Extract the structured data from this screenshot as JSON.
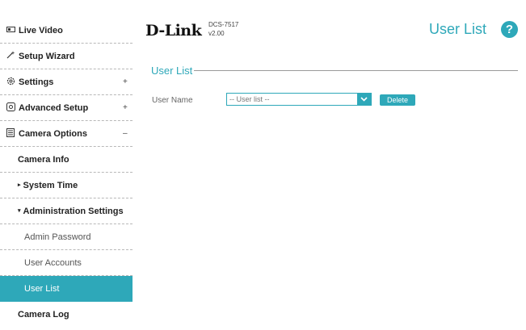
{
  "header": {
    "logo_text": "D-Link",
    "model": "DCS-7517",
    "version": "v2.00",
    "page_title": "User List",
    "help_glyph": "?"
  },
  "sidebar": {
    "items": [
      {
        "label": "Live Video",
        "icon": "video-icon"
      },
      {
        "label": "Setup Wizard",
        "icon": "wand-icon"
      },
      {
        "label": "Settings",
        "icon": "gear-icon",
        "toggle": "+"
      },
      {
        "label": "Advanced Setup",
        "icon": "advanced-gear-icon",
        "toggle": "+"
      },
      {
        "label": "Camera Options",
        "icon": "list-icon",
        "toggle": "–"
      },
      {
        "label": "Camera Info"
      },
      {
        "label": "System Time",
        "caret": "▸"
      },
      {
        "label": "Administration Settings",
        "caret": "▾"
      },
      {
        "label": "Admin Password"
      },
      {
        "label": "User Accounts"
      },
      {
        "label": "User List",
        "active": true
      },
      {
        "label": "Camera Log"
      }
    ]
  },
  "main": {
    "section_title": "User List",
    "user_name_label": "User Name",
    "user_select_value": "-- User list --",
    "delete_label": "Delete"
  },
  "colors": {
    "accent": "#2ea8b9"
  }
}
